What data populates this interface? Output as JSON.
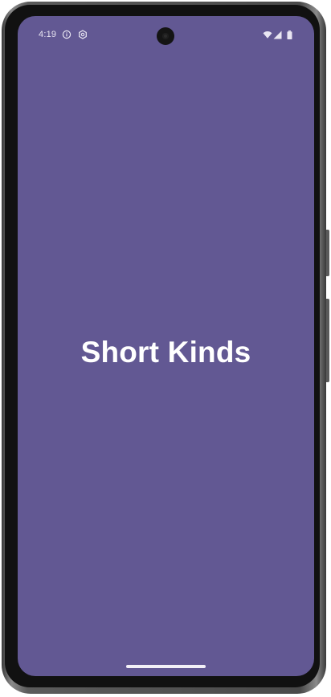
{
  "status_bar": {
    "time": "4:19",
    "left_icons": [
      "info-icon",
      "settings-icon"
    ],
    "right_icons": [
      "wifi-icon",
      "signal-icon",
      "battery-icon"
    ]
  },
  "splash": {
    "title": "Short Kinds"
  },
  "colors": {
    "background": "#625893",
    "title": "#ffffff",
    "frame": "#4a4a4a"
  }
}
